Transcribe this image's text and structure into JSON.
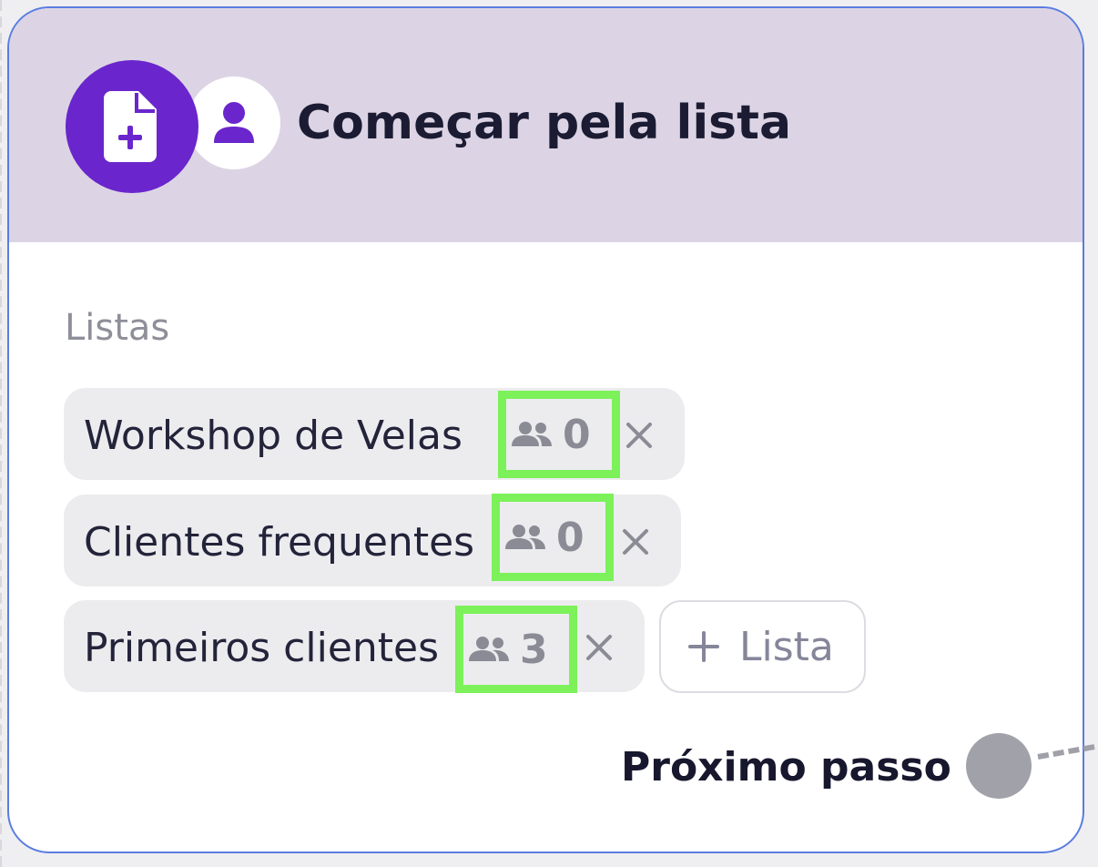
{
  "card": {
    "title": "Começar pela lista",
    "icons": {
      "primary": "document-add-icon",
      "secondary": "user-icon"
    }
  },
  "lists": {
    "label": "Listas",
    "items": [
      {
        "name": "Workshop de Velas",
        "count": "0",
        "icon": "people-icon",
        "remove_icon": "close-icon"
      },
      {
        "name": "Clientes frequentes",
        "count": "0",
        "icon": "people-icon",
        "remove_icon": "close-icon"
      },
      {
        "name": "Primeiros clientes",
        "count": "3",
        "icon": "people-icon",
        "remove_icon": "close-icon"
      }
    ],
    "add_label": "Lista"
  },
  "footer": {
    "next_label": "Próximo passo"
  },
  "colors": {
    "accent": "#6a26cc",
    "header_bg": "#dcd4e4",
    "highlight": "#7cf15a",
    "card_border": "#5a7ce0"
  }
}
